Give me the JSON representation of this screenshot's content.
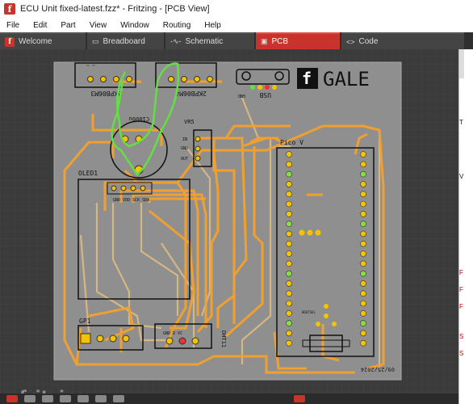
{
  "window": {
    "title": "ECU Unit fixed-latest.fzz* - Fritzing - [PCB View]"
  },
  "menu": [
    "File",
    "Edit",
    "Part",
    "View",
    "Window",
    "Routing",
    "Help"
  ],
  "tabs": [
    {
      "label": "Welcome",
      "icon": "fritzing-icon",
      "active": false
    },
    {
      "label": "Breadboard",
      "icon": "breadboard-icon",
      "active": false
    },
    {
      "label": "Schematic",
      "icon": "schematic-icon",
      "active": false
    },
    {
      "label": "PCB",
      "icon": "pcb-icon",
      "active": true
    },
    {
      "label": "Code",
      "icon": "code-icon",
      "active": false
    }
  ],
  "pcb": {
    "board_name": "GALE",
    "labels": {
      "conn1": "2KPB06M3",
      "conn2": "2KPB06M4",
      "usb": "USB",
      "usb_gnd": "GND",
      "cap": "C1000u",
      "vr": "VR5",
      "vr_in": "IN",
      "vr_gnd": "GND",
      "vr_out": "OUT",
      "oled": "OLED1",
      "oled_pins": "GND VDD SCK SDA",
      "pico": "Pico V",
      "gp": "GP1",
      "dht": "DHT11",
      "dht_pins": "GND  D VC",
      "footer": "09/25/2024",
      "chip_text": "BOOTSEL"
    }
  },
  "watermark": "fritzing",
  "side_panel": [
    "T",
    "V",
    "F",
    "F",
    "F",
    "S",
    "S"
  ],
  "colors": {
    "board": "#8f8f8f",
    "trace": "#f0a030",
    "trace_bottom": "#e8c080",
    "pad": "#f5c400",
    "selection": "#66dd44",
    "accent": "#c8332c"
  }
}
